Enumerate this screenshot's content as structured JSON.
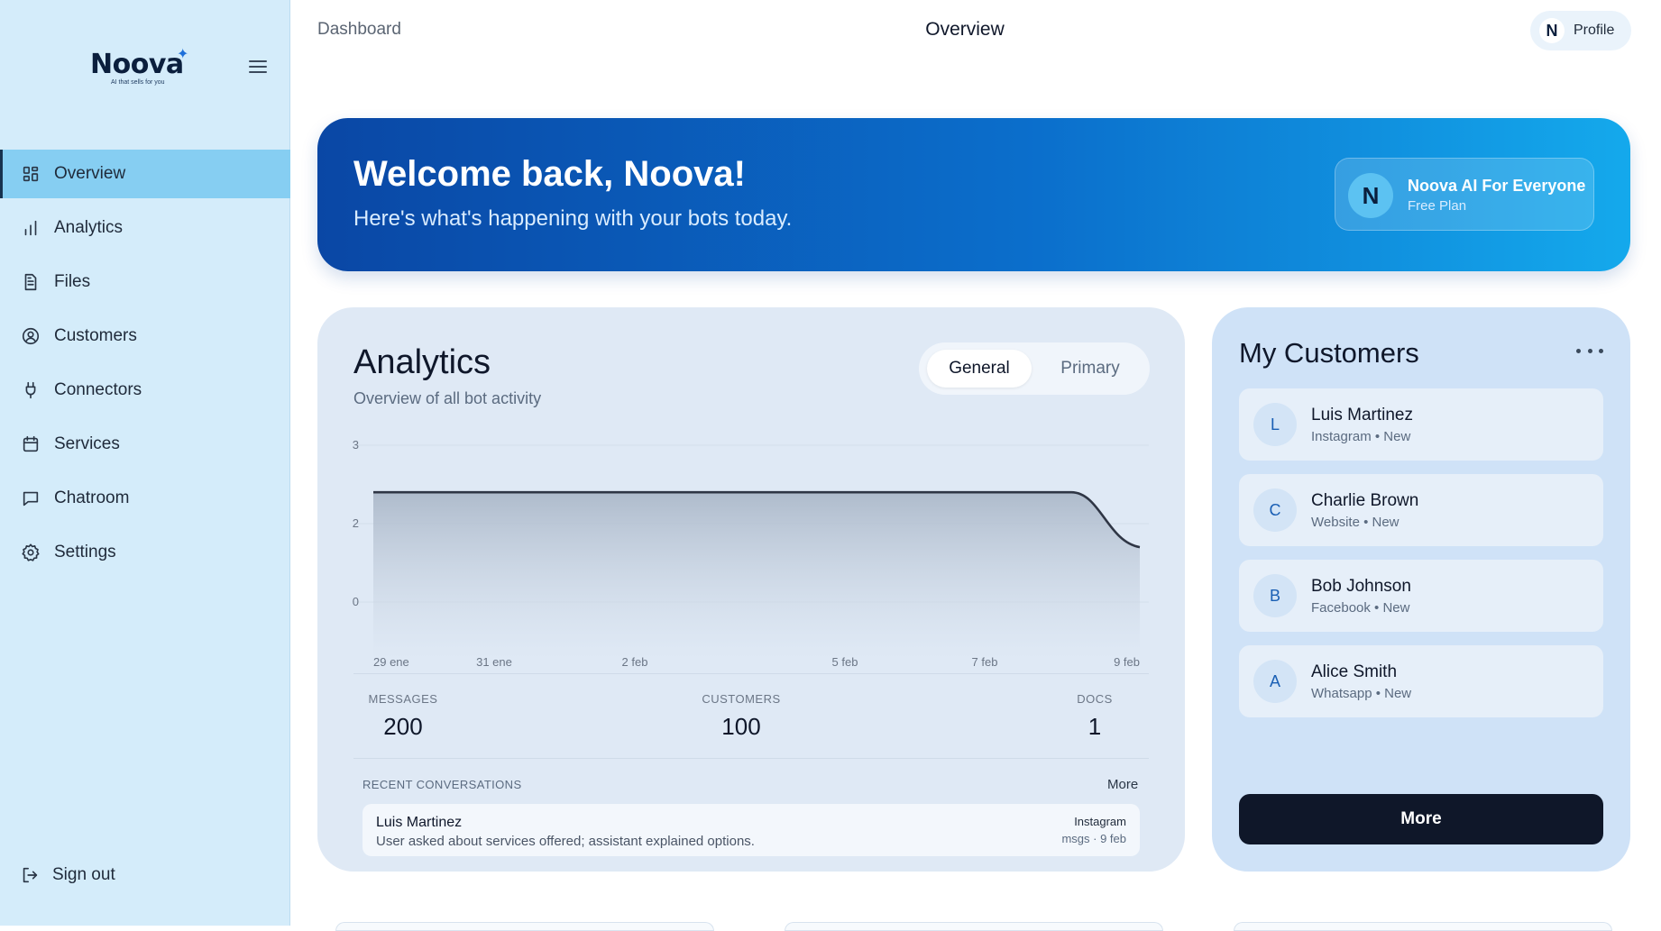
{
  "brand": {
    "name": "Noova",
    "tagline": "AI that sells for you"
  },
  "sidebar": {
    "items": [
      {
        "label": "Overview",
        "icon": "grid-icon",
        "active": true
      },
      {
        "label": "Analytics",
        "icon": "bar-chart-icon",
        "active": false
      },
      {
        "label": "Files",
        "icon": "file-icon",
        "active": false
      },
      {
        "label": "Customers",
        "icon": "user-circle-icon",
        "active": false
      },
      {
        "label": "Connectors",
        "icon": "plug-icon",
        "active": false
      },
      {
        "label": "Services",
        "icon": "calendar-icon",
        "active": false
      },
      {
        "label": "Chatroom",
        "icon": "chat-icon",
        "active": false
      },
      {
        "label": "Settings",
        "icon": "gear-icon",
        "active": false
      }
    ],
    "sign_out": "Sign out"
  },
  "header": {
    "breadcrumb": "Dashboard",
    "title": "Overview",
    "profile_label": "Profile",
    "profile_initial": "N"
  },
  "hero": {
    "title": "Welcome back, Noova!",
    "subtitle": "Here's what's happening with your bots today.",
    "plan_initial": "N",
    "plan_name": "Noova AI For Everyone",
    "plan_type": "Free Plan"
  },
  "analytics": {
    "title": "Analytics",
    "subtitle": "Overview of all bot activity",
    "tabs": [
      "General",
      "Primary"
    ],
    "active_tab": "General",
    "stats": [
      {
        "label": "MESSAGES",
        "value": "200"
      },
      {
        "label": "CUSTOMERS",
        "value": "100"
      },
      {
        "label": "DOCS",
        "value": "1"
      }
    ],
    "recent_heading": "RECENT CONVERSATIONS",
    "recent_more": "More",
    "conversations": [
      {
        "name": "Luis Martinez",
        "summary": "User asked about services offered; assistant explained options.",
        "source": "Instagram",
        "meta": "msgs · 9 feb"
      }
    ]
  },
  "chart_data": {
    "type": "area",
    "x": [
      "29 ene",
      "31 ene",
      "2 feb",
      "5 feb",
      "7 feb",
      "9 feb"
    ],
    "series": [
      {
        "values": [
          2.4,
          2.4,
          2.4,
          2.4,
          2.4,
          1.4
        ]
      }
    ],
    "ytick_labels": [
      "3",
      "2",
      "0"
    ],
    "grid": true,
    "colors": {
      "line": "#2f3645",
      "fill_top": "#a9b6c7",
      "fill_bottom": "#dfe9f5"
    }
  },
  "customers": {
    "title": "My Customers",
    "list": [
      {
        "initial": "L",
        "name": "Luis Martinez",
        "detail": "Instagram • New"
      },
      {
        "initial": "C",
        "name": "Charlie Brown",
        "detail": "Website • New"
      },
      {
        "initial": "B",
        "name": "Bob Johnson",
        "detail": "Facebook • New"
      },
      {
        "initial": "A",
        "name": "Alice Smith",
        "detail": "Whatsapp • New"
      }
    ],
    "more_label": "More"
  },
  "colors": {
    "sidebar_bg": "#d4ecfa",
    "active_nav": "#86cef2",
    "hero_start": "#0a47a5",
    "hero_end": "#14a9ec",
    "button_dark": "#0f1729"
  }
}
